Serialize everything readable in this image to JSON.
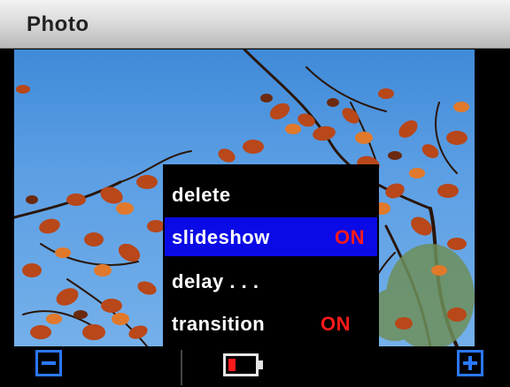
{
  "window": {
    "title": "Photo"
  },
  "photo": {
    "icon": "autumn-leaves-photo"
  },
  "menu": {
    "items": [
      {
        "label": "delete",
        "value": ""
      },
      {
        "label": "slideshow",
        "value": "ON",
        "selected": true
      },
      {
        "label": "delay  . . .",
        "value": ""
      },
      {
        "label": "transition",
        "value": "ON"
      }
    ]
  },
  "toolbar": {
    "zoom_out_icon": "minus-icon",
    "zoom_in_icon": "plus-icon",
    "battery_icon": "battery-icon",
    "battery_level": 0.28
  },
  "colors": {
    "title_bar": "#c8c8c8",
    "menu_bg": "#000000",
    "selected_bg": "#0a0ae6",
    "value_on": "#ff1a1a",
    "button_accent": "#2a78ff",
    "battery_low": "#ff1a1a"
  }
}
